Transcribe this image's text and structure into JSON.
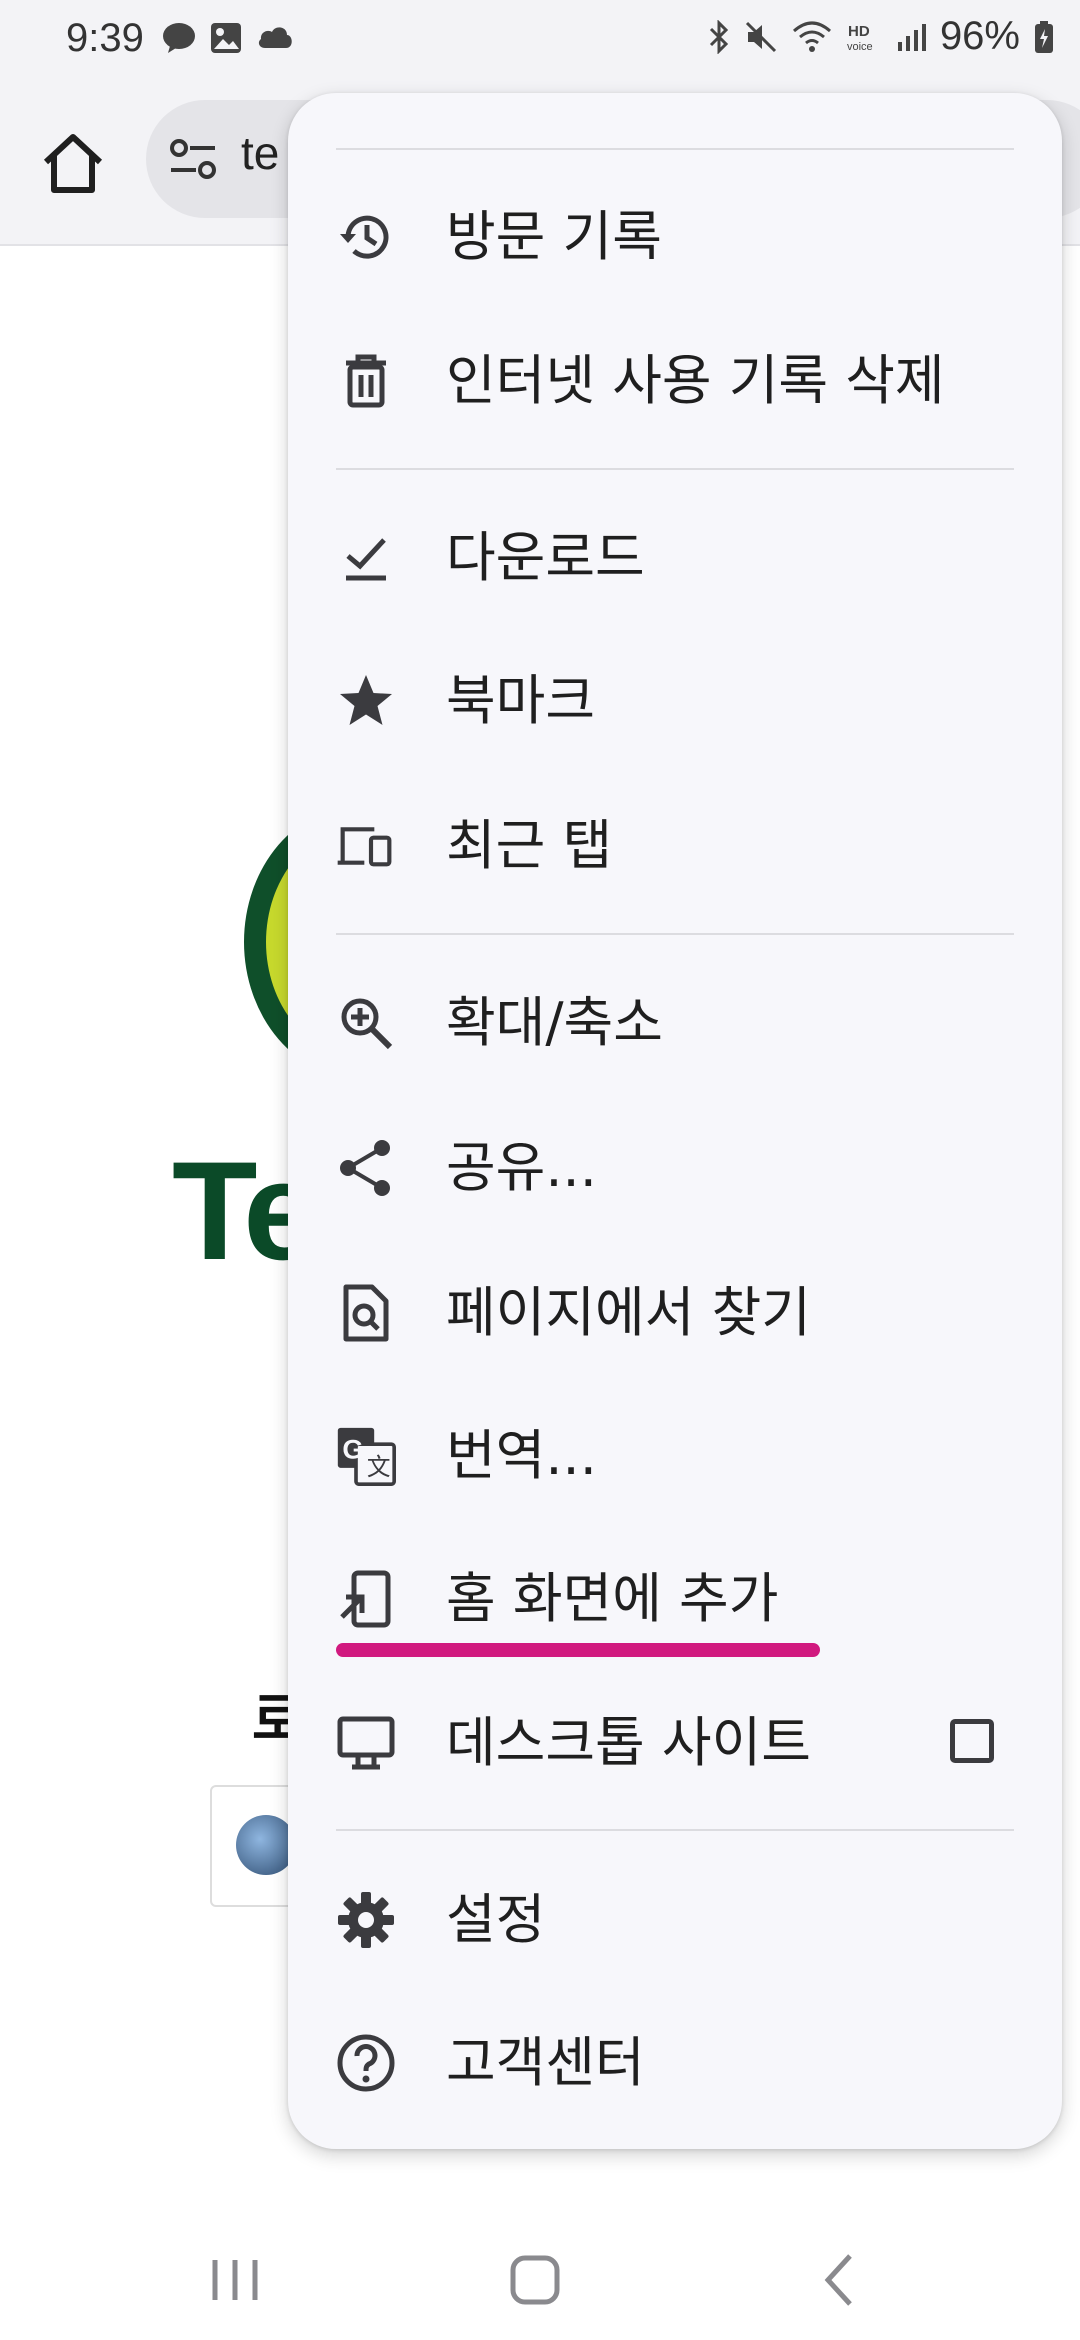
{
  "status_bar": {
    "time": "9:39",
    "battery": "96%",
    "left_icons": [
      "kakaotalk-icon",
      "gallery-icon",
      "cloud-icon"
    ],
    "right_icons": [
      "bluetooth-icon",
      "mute-icon",
      "wifi-icon",
      "hd-voice-icon",
      "signal-icon",
      "battery-icon"
    ]
  },
  "toolbar": {
    "url_partial": "te"
  },
  "page": {
    "brand_partial": "Te",
    "section_partial": "로"
  },
  "menu": {
    "items": [
      {
        "label": "방문 기록",
        "icon": "history-icon"
      },
      {
        "label": "인터넷 사용 기록 삭제",
        "icon": "trash-icon"
      },
      {
        "label": "다운로드",
        "icon": "download-done-icon"
      },
      {
        "label": "북마크",
        "icon": "star-icon"
      },
      {
        "label": "최근 탭",
        "icon": "devices-icon"
      },
      {
        "label": "확대/축소",
        "icon": "zoom-in-icon"
      },
      {
        "label": "공유...",
        "icon": "share-icon"
      },
      {
        "label": "페이지에서 찾기",
        "icon": "find-in-page-icon"
      },
      {
        "label": "번역...",
        "icon": "translate-icon"
      },
      {
        "label": "홈 화면에 추가",
        "icon": "add-to-home-icon"
      },
      {
        "label": "데스크톱 사이트",
        "icon": "desktop-icon"
      },
      {
        "label": "설정",
        "icon": "gear-icon"
      },
      {
        "label": "고객센터",
        "icon": "help-icon"
      }
    ],
    "desktop_site_checked": false
  },
  "colors": {
    "menu_bg": "#f7f7fb",
    "icon": "#3b3b3f",
    "highlight": "#d1197f",
    "brand_green": "#0b4a28"
  }
}
